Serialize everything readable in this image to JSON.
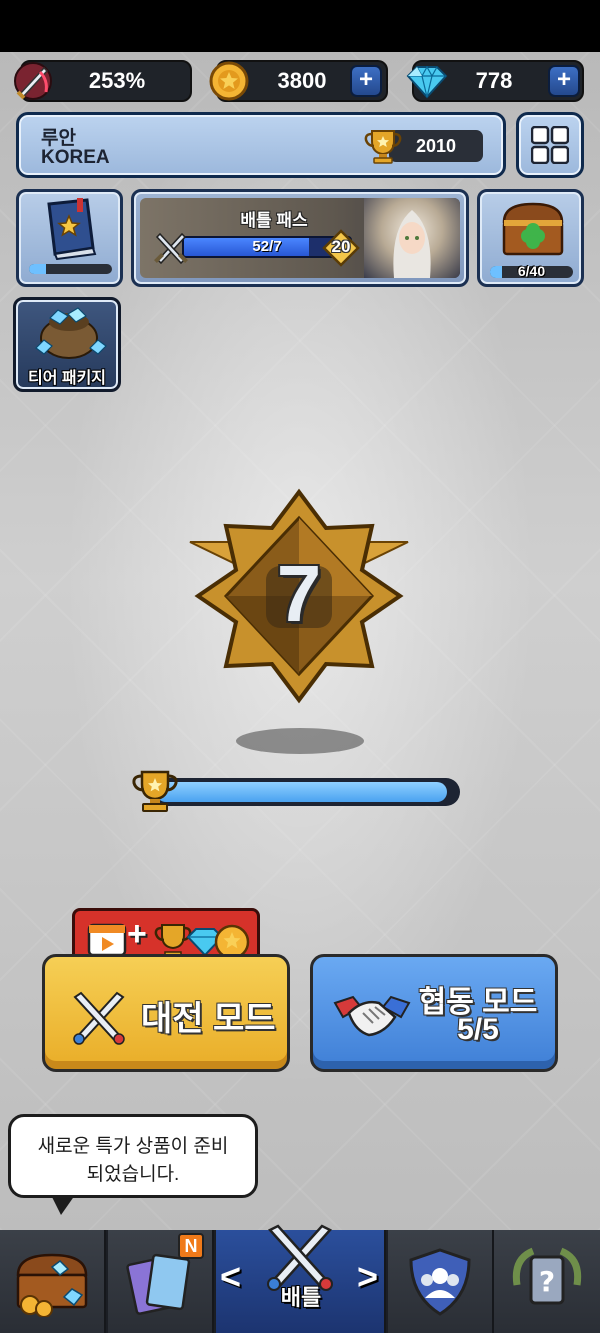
{
  "resources": {
    "power_percent": "253%",
    "gold": "3800",
    "gems": "778",
    "plus_label": "+"
  },
  "profile": {
    "name": "루안",
    "country": "KOREA",
    "trophies": "2010"
  },
  "battle_pass": {
    "title": "배틀 패스",
    "progress_text": "52/7",
    "progress_fraction": 0.75,
    "level": "20"
  },
  "chest": {
    "progress_text": "6/40",
    "progress_fraction": 0.15
  },
  "book": {
    "progress_fraction": 0.2
  },
  "tier_package": {
    "label": "티어 패키지"
  },
  "rank": {
    "tier_number": "7",
    "trophy_progress_fraction": 0.97
  },
  "modes": {
    "pvp_label": "대전 모드",
    "coop_label": "협동 모드",
    "coop_count": "5/5",
    "plus_sign": "+"
  },
  "speech_bubble": {
    "text_line1": "새로운 특가 상품이 준비",
    "text_line2": "되었습니다."
  },
  "tabs": {
    "battle_label": "배틀",
    "new_badge": "N",
    "arrow_left": "<",
    "arrow_right": ">"
  },
  "colors": {
    "accent_blue": "#3d6fc4",
    "pvp_yellow": "#f1bd3a",
    "coop_blue": "#4c8ee6",
    "bar_blue": "#6ec0ff"
  }
}
